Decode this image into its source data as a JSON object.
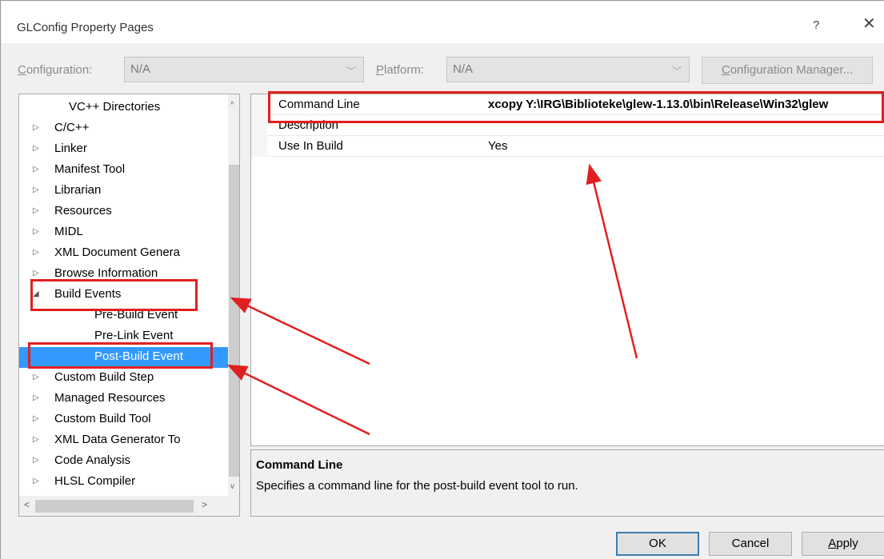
{
  "window": {
    "title": "GLConfig Property Pages",
    "help_label": "?",
    "close_label": "✕"
  },
  "toolbar": {
    "configuration_label_prefix": "C",
    "configuration_label_rest": "onfiguration:",
    "configuration_value": "N/A",
    "platform_label_prefix": "P",
    "platform_label_rest": "latform:",
    "platform_value": "N/A",
    "config_manager_prefix": "C",
    "config_manager_rest": "onfiguration Manager..."
  },
  "tree": {
    "items": [
      {
        "label": "VC++ Directories",
        "expander": ""
      },
      {
        "label": "C/C++",
        "expander": "▷"
      },
      {
        "label": "Linker",
        "expander": "▷"
      },
      {
        "label": "Manifest Tool",
        "expander": "▷"
      },
      {
        "label": "Librarian",
        "expander": "▷"
      },
      {
        "label": "Resources",
        "expander": "▷"
      },
      {
        "label": "MIDL",
        "expander": "▷"
      },
      {
        "label": "XML Document Genera",
        "expander": "▷"
      },
      {
        "label": "Browse Information",
        "expander": "▷"
      },
      {
        "label": "Build Events",
        "expander": "◢"
      },
      {
        "label": "Pre-Build Event",
        "expander": ""
      },
      {
        "label": "Pre-Link Event",
        "expander": ""
      },
      {
        "label": "Post-Build Event",
        "expander": ""
      },
      {
        "label": "Custom Build Step",
        "expander": "▷"
      },
      {
        "label": "Managed Resources",
        "expander": "▷"
      },
      {
        "label": "Custom Build Tool",
        "expander": "▷"
      },
      {
        "label": "XML Data Generator To",
        "expander": "▷"
      },
      {
        "label": "Code Analysis",
        "expander": "▷"
      },
      {
        "label": "HLSL Compiler",
        "expander": "▷"
      }
    ],
    "scroll_up": "^",
    "scroll_down": "v",
    "scroll_left": "<",
    "scroll_right": ">"
  },
  "properties": {
    "rows": [
      {
        "name": "Command Line",
        "value": "xcopy Y:\\IRG\\Biblioteke\\glew-1.13.0\\bin\\Release\\Win32\\glew"
      },
      {
        "name": "Description",
        "value": ""
      },
      {
        "name": "Use In Build",
        "value": "Yes"
      }
    ]
  },
  "description": {
    "title": "Command Line",
    "text": "Specifies a command line for the post-build event tool to run."
  },
  "buttons": {
    "ok": "OK",
    "cancel": "Cancel",
    "apply_prefix": "A",
    "apply_rest": "pply"
  },
  "colors": {
    "selection": "#3399ff",
    "annotation": "#e02020"
  }
}
